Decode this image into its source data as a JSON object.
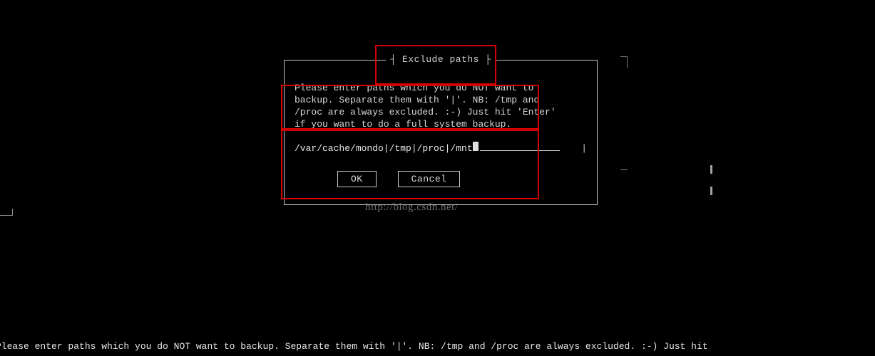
{
  "dialog": {
    "title": "┤ Exclude paths ├",
    "message": "Please enter paths which you do NOT want to\nbackup. Separate them with '|'. NB: /tmp and\n/proc are always excluded. :-) Just hit 'Enter'\nif you want to do a full system backup.",
    "input_value": "/var/cache/mondo|/tmp|/proc|/mnt",
    "scroll_indicator": "|",
    "buttons": {
      "ok": "OK",
      "cancel": "Cancel"
    }
  },
  "watermark": "http://blog.csdn.net/",
  "statusbar": "Please enter paths which you do NOT want to backup. Separate them with '|'. NB: /tmp and /proc are always excluded. :-) Just hit"
}
